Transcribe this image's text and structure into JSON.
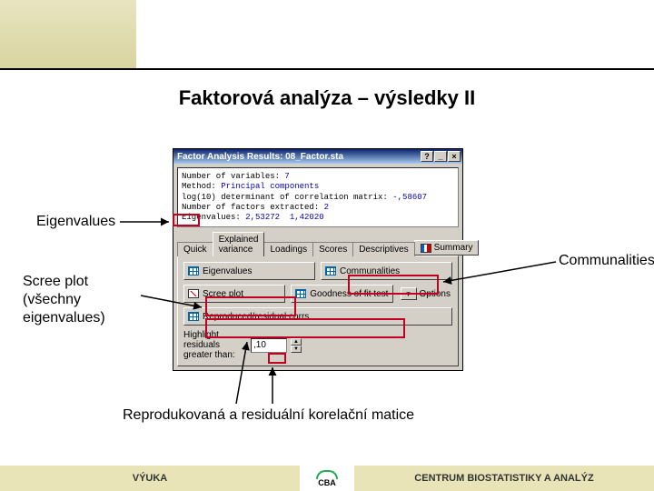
{
  "slide": {
    "title": "Faktorová analýza – výsledky II"
  },
  "labels": {
    "eigen": "Eigenvalues",
    "comm": "Communalities",
    "scree": "Scree plot (všechny eigenvalues)",
    "repro": "Reprodukovaná a residuální korelační matice"
  },
  "dialog": {
    "title": "Factor Analysis Results: 08_Factor.sta",
    "info_l1a": "Number of variables: ",
    "info_l1b": "7",
    "info_l2a": "Method: ",
    "info_l2b": "Principal components",
    "info_l3a": "log(10) determinant of correlation matrix: ",
    "info_l3b": "-,58607",
    "info_l4a": "Number of factors extracted: ",
    "info_l4b": "2",
    "info_l5a": "Eigenvalues: ",
    "info_l5b": "2,53272  1,42020",
    "tabs": {
      "quick": "Quick",
      "explained": "Explained variance",
      "loadings": "Loadings",
      "scores": "Scores",
      "descriptives": "Descriptives"
    },
    "summary": "Summary",
    "buttons": {
      "eigenvalues": "Eigenvalues",
      "communalities": "Communalities",
      "scree": "Scree plot",
      "goodness": "Goodness of fit test",
      "options": "Options",
      "reprod": "Reproduced/residual corrs."
    },
    "field": {
      "label": "Highlight residuals greater than:",
      "value": ",10"
    }
  },
  "footer": {
    "left": "VÝUKA",
    "right": "CENTRUM BIOSTATISTIKY A ANALÝZ",
    "logo": "CBA"
  }
}
